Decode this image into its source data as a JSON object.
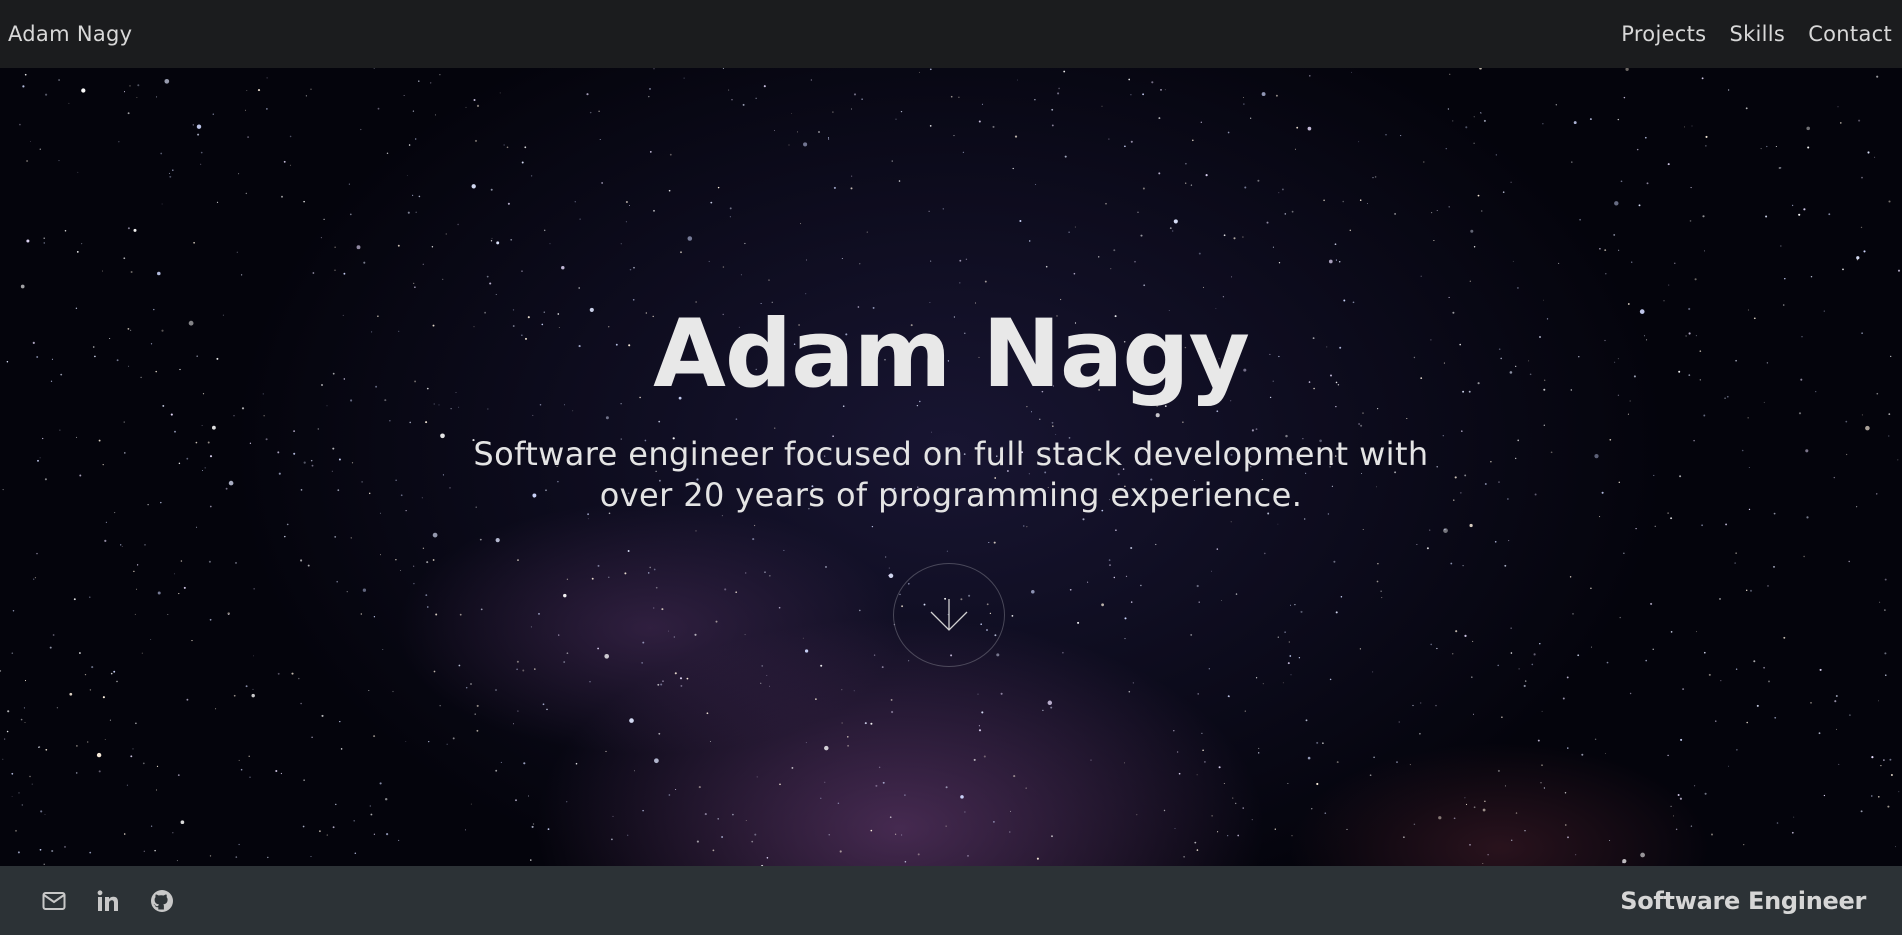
{
  "header": {
    "brand": "Adam Nagy",
    "nav": [
      {
        "label": "Projects"
      },
      {
        "label": "Skills"
      },
      {
        "label": "Contact"
      }
    ]
  },
  "hero": {
    "title": "Adam Nagy",
    "subtitle_line1": "Software engineer focused on full stack development with",
    "subtitle_line2": "over 20 years of programming experience.",
    "scroll_icon": "arrow-down-icon"
  },
  "footer": {
    "socials": [
      {
        "icon": "mail-icon"
      },
      {
        "icon": "linkedin-icon"
      },
      {
        "icon": "github-icon"
      }
    ],
    "role": "Software Engineer"
  },
  "colors": {
    "topbar_bg": "#1b1c1e",
    "footer_bg": "#2c3236",
    "text_light": "#e8e8e8"
  }
}
